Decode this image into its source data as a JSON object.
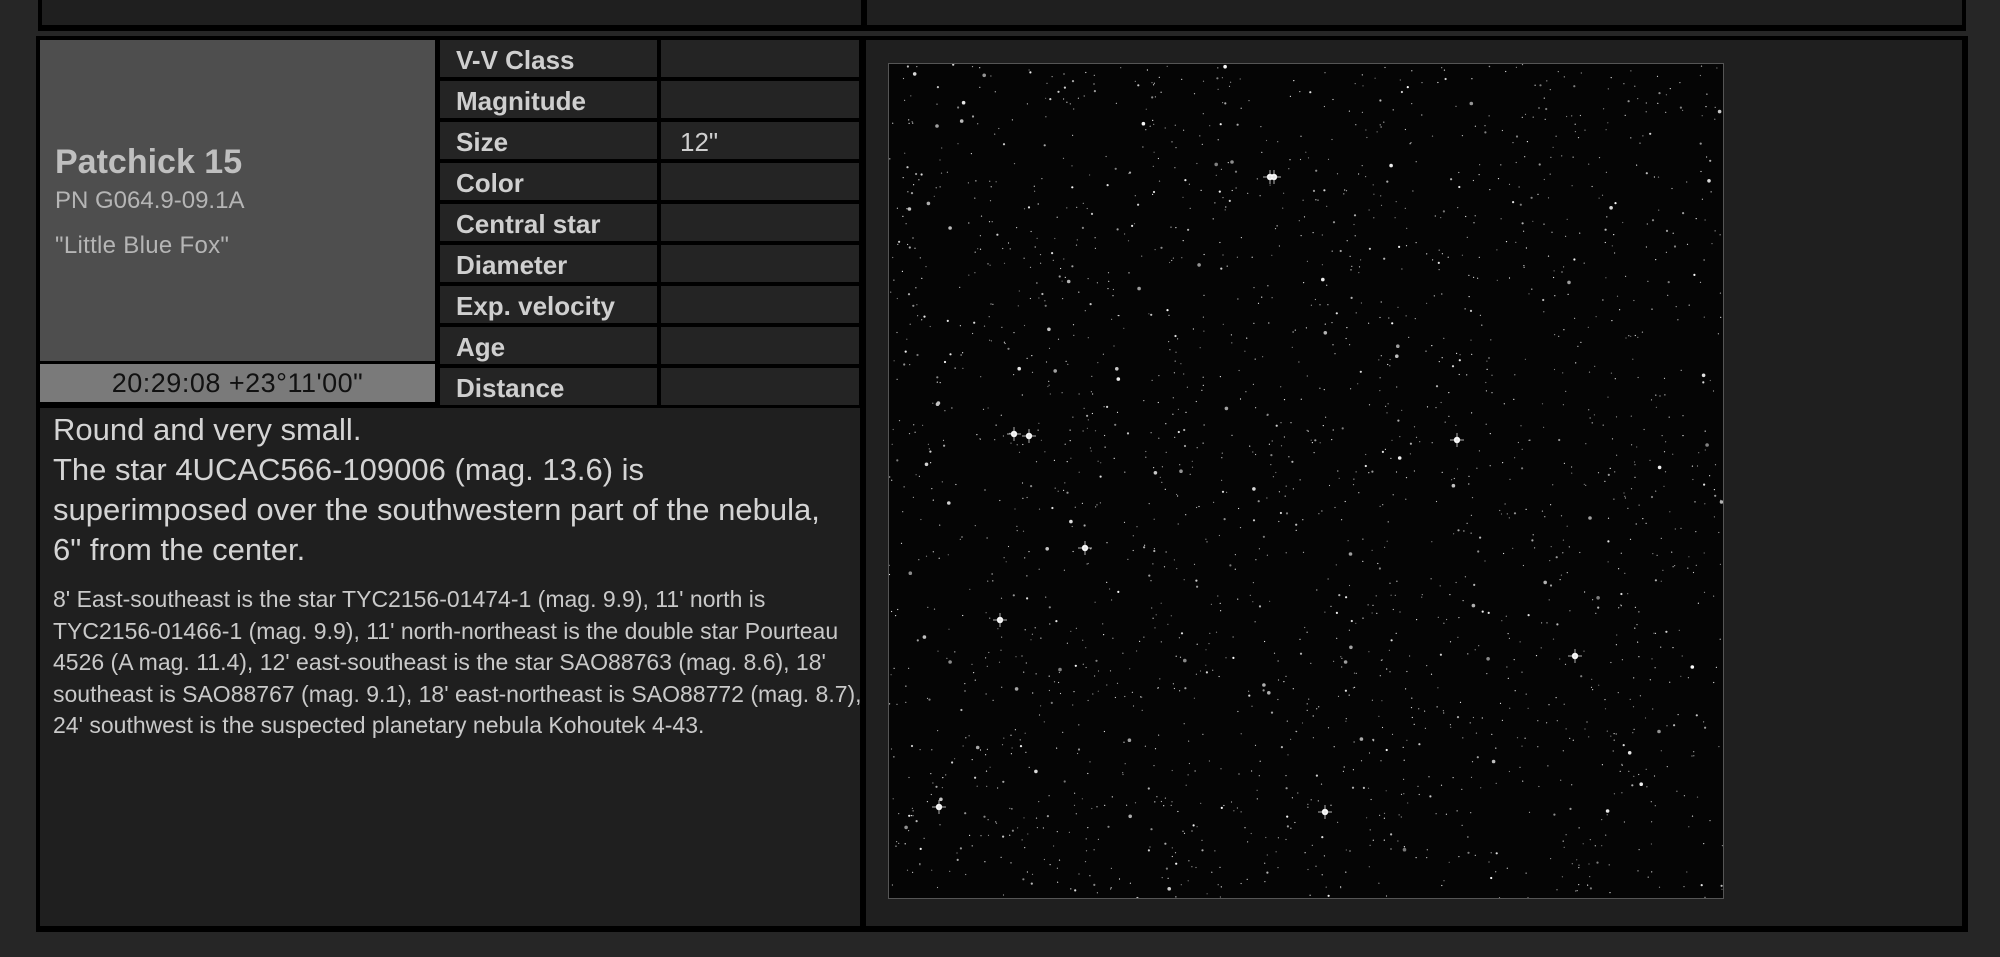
{
  "object": {
    "name": "Patchick 15",
    "designation": "PN G064.9-09.1A",
    "nickname": "\"Little Blue Fox\"",
    "coordinates": "20:29:08 +23°11'00\""
  },
  "properties": [
    {
      "label": "V-V Class",
      "value": ""
    },
    {
      "label": "Magnitude",
      "value": ""
    },
    {
      "label": "Size",
      "value": "12\""
    },
    {
      "label": "Color",
      "value": ""
    },
    {
      "label": "Central star",
      "value": ""
    },
    {
      "label": "Diameter",
      "value": ""
    },
    {
      "label": "Exp. velocity",
      "value": ""
    },
    {
      "label": "Age",
      "value": ""
    },
    {
      "label": "Distance",
      "value": ""
    }
  ],
  "description": {
    "main": "Round and very small.\nThe star 4UCAC566-109006 (mag. 13.6) is superimposed over the southwestern part of the nebula, 6\" from the center.",
    "detail": "8' East-southeast is the star TYC2156-01474-1 (mag. 9.9), 11' north is TYC2156-01466-1 (mag. 9.9), 11' north-northeast is the double star Pourteau 4526 (A mag. 11.4), 12' east-southeast is the star SAO88763 (mag. 8.6), 18' southeast is SAO88767 (mag. 9.1), 18' east-northeast is SAO88772 (mag. 8.7), 24' southwest is the suspected planetary nebula Kohoutek 4-43."
  }
}
